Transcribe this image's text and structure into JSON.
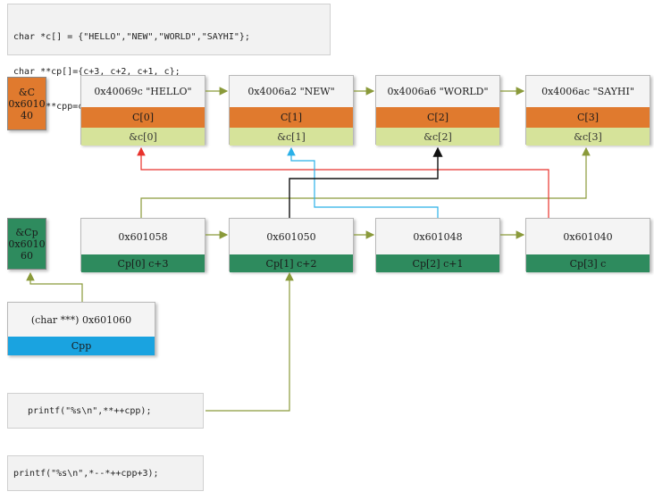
{
  "code_block": {
    "lines": [
      "char *c[] = {\"HELLO\",\"NEW\",\"WORLD\",\"SAYHI\"};",
      "char **cp[]={c+3, c+2, c+1, c};",
      "char ***cpp=cp;"
    ]
  },
  "addr_c": {
    "line1": "&C",
    "line2": "0x6010",
    "line3": "40",
    "color": "#e07a2e"
  },
  "addr_cp": {
    "line1": "&Cp",
    "line2": "0x6010",
    "line3": "60",
    "color": "#2e8b5e"
  },
  "c_nodes": [
    {
      "value": "0x40069c \"HELLO\"",
      "name": "C[0]",
      "addr": "&c[0]"
    },
    {
      "value": "0x4006a2 \"NEW\"",
      "name": "C[1]",
      "addr": "&c[1]"
    },
    {
      "value": "0x4006a6 \"WORLD\"",
      "name": "C[2]",
      "addr": "&c[2]"
    },
    {
      "value": "0x4006ac \"SAYHI\"",
      "name": "C[3]",
      "addr": "&c[3]"
    }
  ],
  "cp_nodes": [
    {
      "value": "0x601058",
      "name": "Cp[0]  c+3"
    },
    {
      "value": "0x601050",
      "name": "Cp[1]  c+2"
    },
    {
      "value": "0x601048",
      "name": "Cp[2]  c+1"
    },
    {
      "value": "0x601040",
      "name": "Cp[3]  c"
    }
  ],
  "cpp_node": {
    "value": "(char ***) 0x601060",
    "name": "Cpp"
  },
  "printf_1": "printf(\"%s\\n\",**++cpp);",
  "printf_2": "printf(\"%s\\n\",*--*++cpp+3);",
  "colors": {
    "orange": "#e07a2e",
    "lime": "#d6e39a",
    "green": "#2e8b5e",
    "blue": "#1aa3e0",
    "olive_arrow": "#8a9a3a",
    "red_arrow": "#e8322c",
    "cyan_arrow": "#2ab0e8",
    "black_arrow": "#111111"
  }
}
